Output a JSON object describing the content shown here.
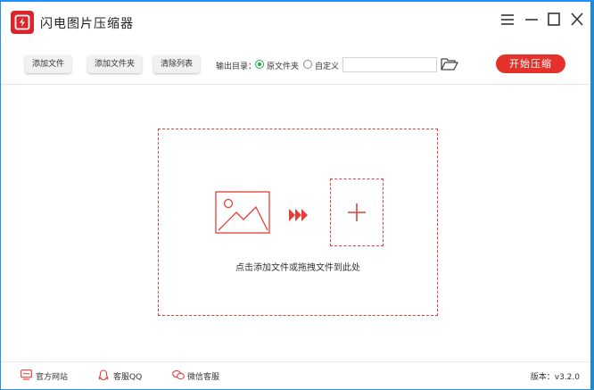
{
  "app": {
    "title": "闪电图片压缩器",
    "accent_color": "#e4322b"
  },
  "toolbar": {
    "add_file": "添加文件",
    "add_folder": "添加文件夹",
    "clear_list": "清除列表",
    "output_label": "输出目录：",
    "option_original": "原文件夹",
    "option_custom": "自定义",
    "selected_option": "原文件夹",
    "path_value": "",
    "start_button": "开始压缩"
  },
  "dropzone": {
    "hint": "点击添加文件或拖拽文件到此处"
  },
  "footer": {
    "website": "官方网站",
    "qq": "客服QQ",
    "wechat": "微信客服",
    "version": "版本：v3.2.0"
  },
  "icons": {
    "menu": "hamburger-menu-icon",
    "minimize": "minimize-icon",
    "maximize": "maximize-icon",
    "close": "close-icon",
    "folder": "open-folder-icon",
    "image": "image-icon",
    "arrows": "triple-arrow-icon",
    "plus": "plus-icon"
  }
}
